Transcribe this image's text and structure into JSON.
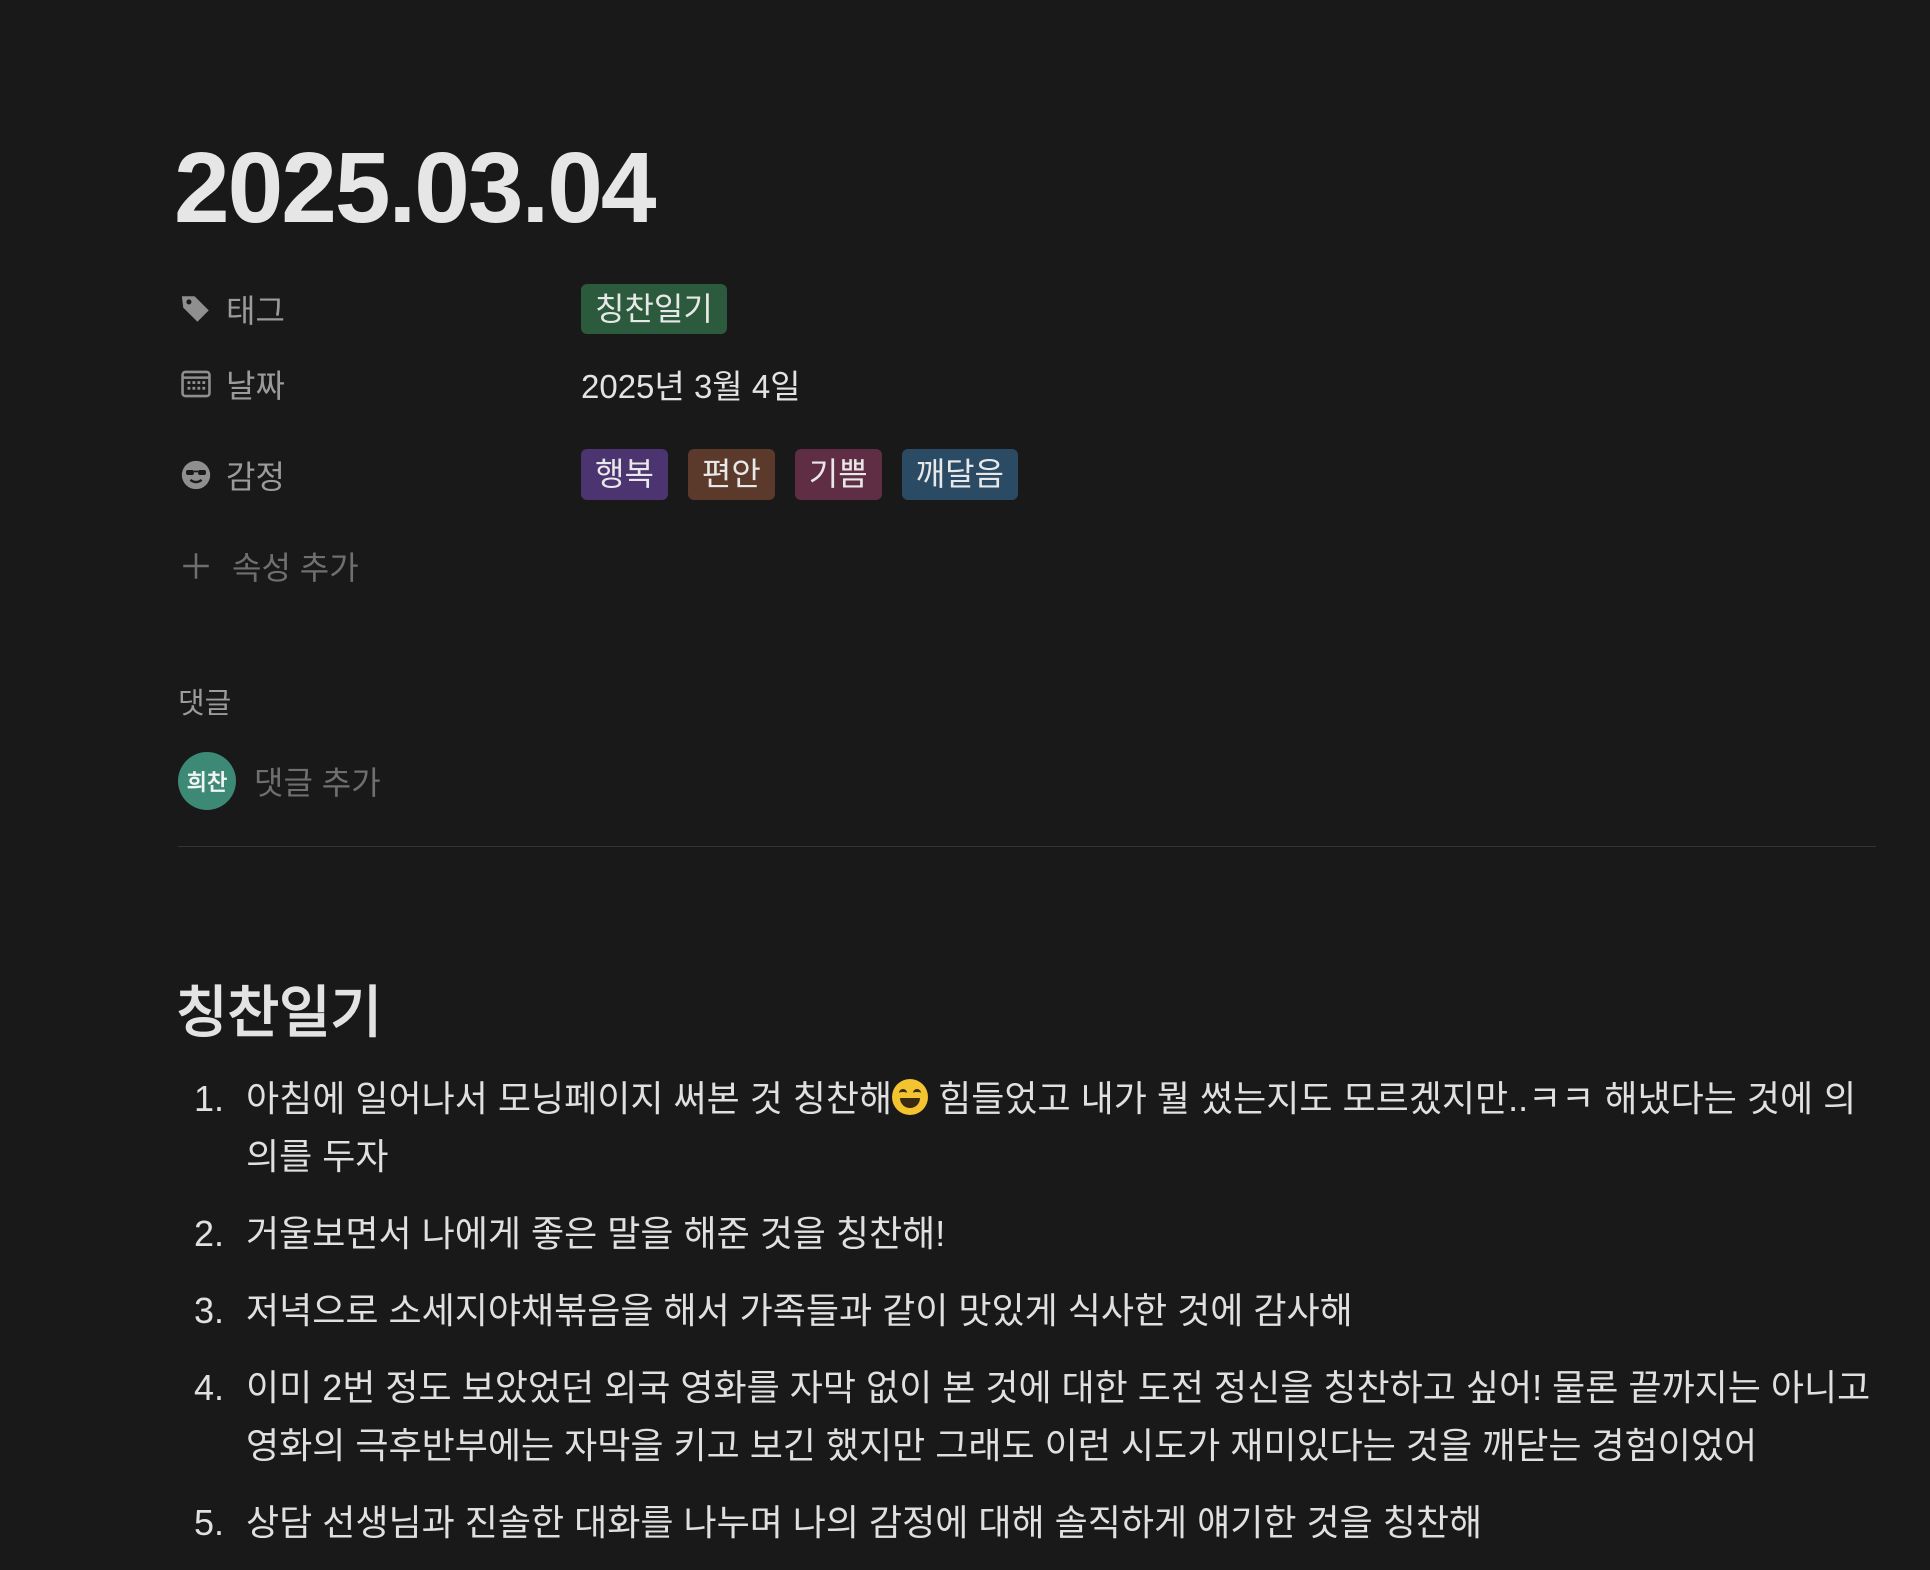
{
  "page": {
    "title": "2025.03.04"
  },
  "properties": {
    "tag": {
      "label": "태그",
      "icon": "tag-icon",
      "value": "칭찬일기"
    },
    "date": {
      "label": "날짜",
      "icon": "calendar-icon",
      "value": "2025년 3월 4일"
    },
    "emotion": {
      "label": "감정",
      "icon": "emoji-sunglasses-icon",
      "values": [
        "행복",
        "편안",
        "기쁨",
        "깨달음"
      ]
    },
    "add_property_label": "속성 추가"
  },
  "colors": {
    "background": "#191919",
    "tag_green": "#2b5a3c",
    "tag_purple": "#4b3470",
    "tag_brown": "#5b3a2c",
    "tag_pink": "#5f2e45",
    "tag_blue": "#2b4a64",
    "avatar": "#3c8a76"
  },
  "comments": {
    "heading": "댓글",
    "avatar_text": "희찬",
    "placeholder": "댓글 추가"
  },
  "content": {
    "heading": "칭찬일기",
    "items": [
      {
        "num": "1.",
        "text_before": "아침에 일어나서 모닝페이지 써본 것 칭찬해",
        "emoji": "grinning-squinting-face",
        "text_after": " 힘들었고 내가 뭘 썼는지도 모르겠지만..ㅋㅋ 해냈다는 것에 의의를 두자"
      },
      {
        "num": "2.",
        "text": "거울보면서 나에게 좋은 말을 해준 것을 칭찬해!"
      },
      {
        "num": "3.",
        "text": "저녁으로 소세지야채볶음을 해서 가족들과 같이 맛있게 식사한 것에 감사해"
      },
      {
        "num": "4.",
        "text": "이미 2번 정도 보았었던 외국 영화를 자막 없이 본 것에 대한 도전 정신을 칭찬하고 싶어! 물론 끝까지는 아니고 영화의 극후반부에는 자막을 키고 보긴 했지만 그래도 이런 시도가 재미있다는 것을 깨닫는 경험이었어"
      },
      {
        "num": "5.",
        "text": "상담 선생님과 진솔한 대화를 나누며 나의 감정에 대해 솔직하게 얘기한 것을 칭찬해"
      }
    ]
  }
}
